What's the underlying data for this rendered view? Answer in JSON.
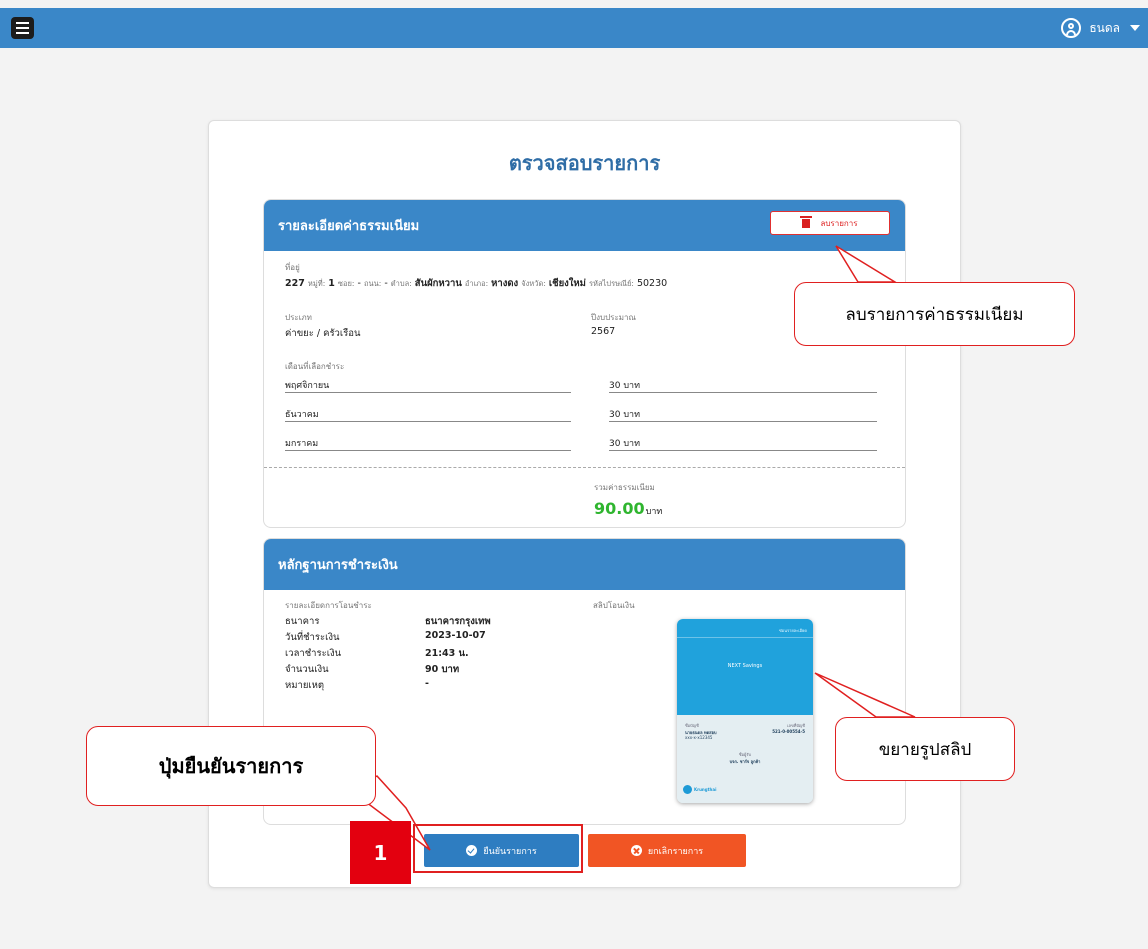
{
  "header": {
    "user_name": "ธนดล"
  },
  "page": {
    "title": "ตรวจสอบรายการ"
  },
  "fee_panel": {
    "title": "รายละเอียดค่าธรรมเนียม",
    "delete_label": "ลบรายการ",
    "address_label": "ที่อยู่",
    "address": {
      "house_no": "227",
      "moo_label": "หมู่ที่:",
      "moo": "1",
      "soi_label": "ซอย:",
      "soi": "-",
      "road_label": "ถนน:",
      "road": "-",
      "tambon_label": "ตำบล:",
      "tambon": "สันผักหวาน",
      "amphoe_label": "อำเภอ:",
      "amphoe": "หางดง",
      "province_label": "จังหวัด:",
      "province": "เชียงใหม่",
      "postcode_label": "รหัสไปรษณีย์:",
      "postcode": "50230"
    },
    "type_label": "ประเภท",
    "type_value": "ค่าขยะ / ครัวเรือน",
    "year_label": "ปีงบประมาณ",
    "year_value": "2567",
    "months_label": "เดือนที่เลือกชำระ",
    "months": [
      {
        "month": "พฤศจิกายน",
        "amount": "30 บาท"
      },
      {
        "month": "ธันวาคม",
        "amount": "30 บาท"
      },
      {
        "month": "มกราคม",
        "amount": "30 บาท"
      }
    ],
    "total_label": "รวมค่าธรรมเนียม",
    "total_value": "90.00",
    "total_unit": "บาท"
  },
  "payment_panel": {
    "title": "หลักฐานการชำระเงิน",
    "details_label": "รายละเอียดการโอนชำระ",
    "slip_label": "สลิปโอนเงิน",
    "rows": [
      {
        "label": "ธนาคาร",
        "value": "ธนาคารกรุงเทพ"
      },
      {
        "label": "วันที่ชำระเงิน",
        "value": "2023-10-07"
      },
      {
        "label": "เวลาชำระเงิน",
        "value": "21:43 น."
      },
      {
        "label": "จำนวนเงิน",
        "value": "90 บาท"
      },
      {
        "label": "หมายเหตุ",
        "value": "-"
      }
    ],
    "slip": {
      "top_text": "ซ่อนรายละเอียด",
      "account_name": "NEXT Savings",
      "from_label": "ชื่อบัญชี",
      "from_name": "นายธนดล ทดสอบ",
      "from_sub": "xxx-x-x12345",
      "account_label": "เลขที่บัญชี",
      "account_no": "521-0-00554-5",
      "to_label": "ชื่อผู้รับ",
      "to_name": "บจก. ชาร์จ ลูกค้า",
      "bank_logo": "Krungthai"
    }
  },
  "actions": {
    "confirm_label": "ยืนยันรายการ",
    "cancel_label": "ยกเลิกรายการ"
  },
  "annotations": {
    "delete_callout": "ลบรายการค่าธรรมเนียม",
    "enlarge_callout": "ขยายรูปสลิป",
    "confirm_callout": "ปุ่มยืนยันรายการ",
    "step_badge": "1"
  },
  "colors": {
    "primary": "#3a87c8",
    "confirm": "#2e7dc1",
    "cancel": "#f15524",
    "total": "#2fb52f",
    "annotation": "#e02020"
  }
}
